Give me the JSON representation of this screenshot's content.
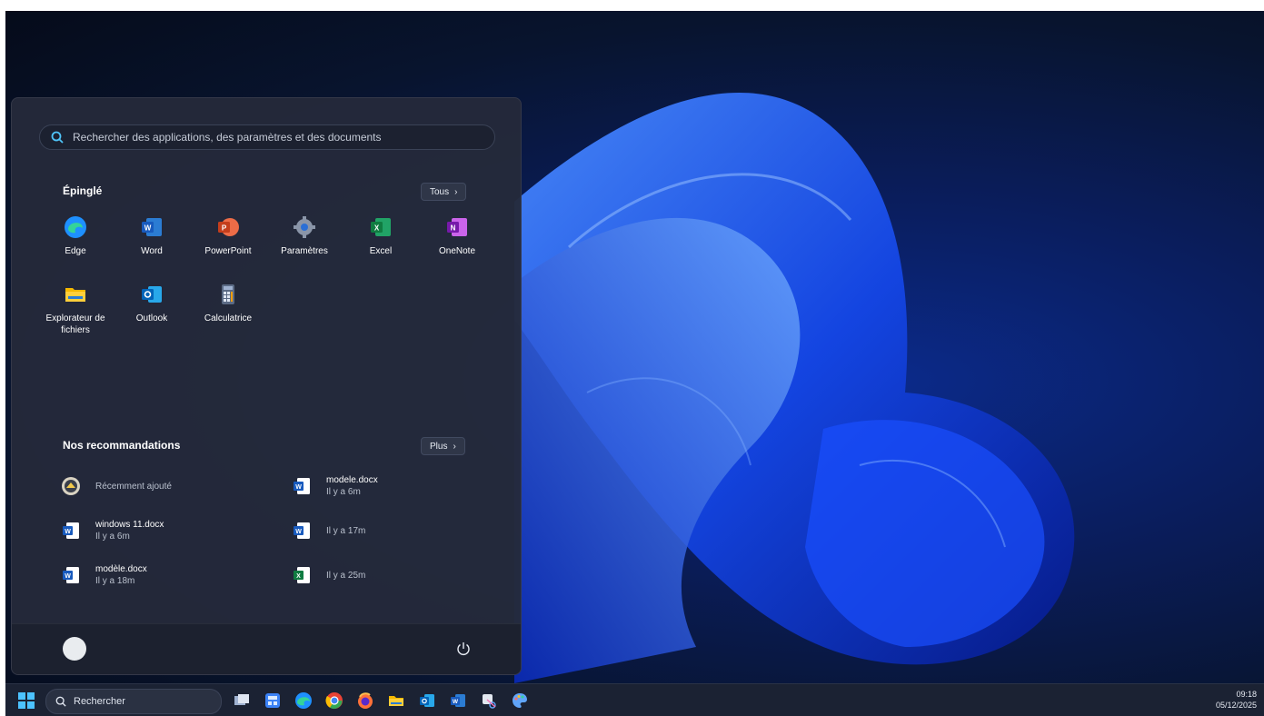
{
  "start_menu": {
    "search_placeholder": "Rechercher des applications, des paramètres et des documents",
    "pinned_title": "Épinglé",
    "all_button": "Tous",
    "pinned_apps": [
      {
        "label": "Edge",
        "icon": "edge-icon"
      },
      {
        "label": "Word",
        "icon": "word-icon"
      },
      {
        "label": "PowerPoint",
        "icon": "powerpoint-icon"
      },
      {
        "label": "Paramètres",
        "icon": "settings-gear-icon"
      },
      {
        "label": "Excel",
        "icon": "excel-icon"
      },
      {
        "label": "OneNote",
        "icon": "onenote-icon"
      },
      {
        "label": "Explorateur de fichiers",
        "icon": "file-explorer-icon"
      },
      {
        "label": "Outlook",
        "icon": "outlook-icon"
      },
      {
        "label": "Calculatrice",
        "icon": "calculator-icon"
      }
    ],
    "recommended_title": "Nos recommandations",
    "more_button": "Plus",
    "recommended": [
      {
        "name": "",
        "meta": "Récemment ajouté",
        "icon": "app-icon"
      },
      {
        "name": "modele.docx",
        "meta": "Il y a 6m",
        "icon": "word-doc-icon"
      },
      {
        "name": "windows 11.docx",
        "meta": "Il y a 6m",
        "icon": "word-doc-icon"
      },
      {
        "name": "",
        "meta": "Il y a 17m",
        "icon": "word-doc-icon"
      },
      {
        "name": "modèle.docx",
        "meta": "Il y a 18m",
        "icon": "word-doc-icon"
      },
      {
        "name": "",
        "meta": "Il y a 25m",
        "icon": "excel-doc-icon"
      }
    ],
    "user_name": ""
  },
  "taskbar": {
    "search_label": "Rechercher",
    "time": "09:18",
    "date": "05/12/2025"
  },
  "colors": {
    "accent": "#1e90ff",
    "menu_bg": "#242a3a"
  }
}
